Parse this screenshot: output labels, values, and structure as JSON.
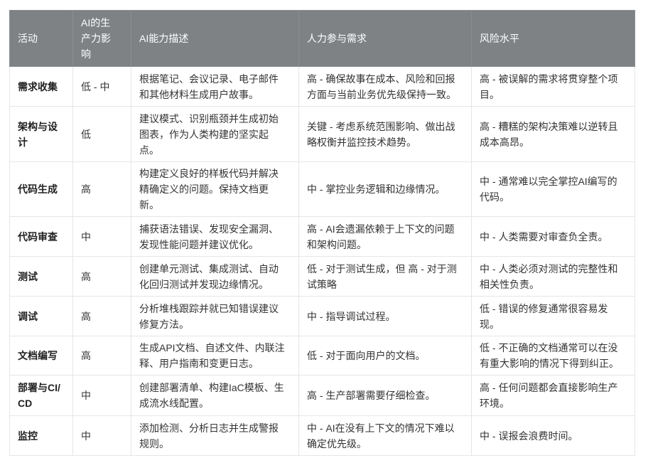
{
  "headers": [
    "活动",
    "AI的生产力影响",
    "AI能力描述",
    "人力参与需求",
    "风险水平"
  ],
  "rows": [
    {
      "activity": "需求收集",
      "impact": "低 - 中",
      "capability": "根据笔记、会议记录、电子邮件和其他材料生成用户故事。",
      "human": "高 - 确保故事在成本、风险和回报方面与当前业务优先级保持一致。",
      "risk": "高 - 被误解的需求将贯穿整个项目。"
    },
    {
      "activity": "架构与设计",
      "impact": "低",
      "capability": "建议模式、识别瓶颈并生成初始图表，作为人类构建的坚实起点。",
      "human": "关键 - 考虑系统范围影响、做出战略权衡并监控技术趋势。",
      "risk": "高 - 糟糕的架构决策难以逆转且成本高昂。"
    },
    {
      "activity": "代码生成",
      "impact": "高",
      "capability": "构建定义良好的样板代码并解决精确定义的问题。保持文档更新。",
      "human": "中 - 掌控业务逻辑和边缘情况。",
      "risk": "中 - 通常难以完全掌控AI编写的代码。"
    },
    {
      "activity": "代码审查",
      "impact": "中",
      "capability": "捕获语法错误、发现安全漏洞、发现性能问题并建议优化。",
      "human": "高 - AI会遗漏依赖于上下文的问题和架构问题。",
      "risk": "中 - 人类需要对审查负全责。"
    },
    {
      "activity": "测试",
      "impact": "高",
      "capability": "创建单元测试、集成测试、自动化回归测试并发现边缘情况。",
      "human": "低 - 对于测试生成，但 高 - 对于测试策略",
      "risk": "中 - 人类必须对测试的完整性和相关性负责。"
    },
    {
      "activity": "调试",
      "impact": "高",
      "capability": "分析堆栈跟踪并就已知错误建议修复方法。",
      "human": "中 - 指导调试过程。",
      "risk": "低 - 错误的修复通常很容易发现。"
    },
    {
      "activity": "文档编写",
      "impact": "高",
      "capability": "生成API文档、自述文件、内联注释、用户指南和变更日志。",
      "human": "低 - 对于面向用户的文档。",
      "risk": "低 - 不正确的文档通常可以在没有重大影响的情况下得到纠正。"
    },
    {
      "activity": "部署与CI/CD",
      "impact": "中",
      "capability": "创建部署清单、构建IaC模板、生成流水线配置。",
      "human": "高 - 生产部署需要仔细检查。",
      "risk": "高 - 任何问题都会直接影响生产环境。"
    },
    {
      "activity": "监控",
      "impact": "中",
      "capability": "添加检测、分析日志并生成警报规则。",
      "human": "中 - AI在没有上下文的情况下难以确定优先级。",
      "risk": "中 - 误报会浪费时间。"
    }
  ]
}
